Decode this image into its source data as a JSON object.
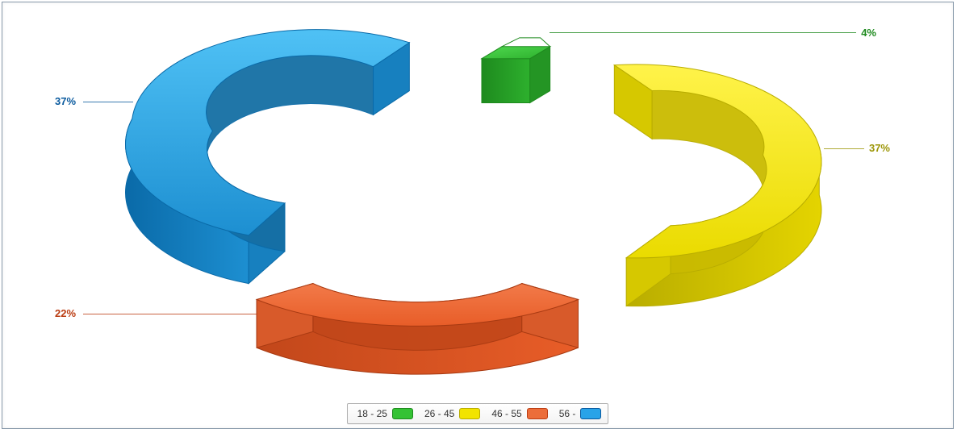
{
  "chart_data": {
    "type": "pie",
    "style": "3d-exploded-donut",
    "series": [
      {
        "name": "18 - 25",
        "value": 4,
        "label": "4%",
        "color": "#34c234"
      },
      {
        "name": "26 - 45",
        "value": 37,
        "label": "37%",
        "color": "#f2e400"
      },
      {
        "name": "46 - 55",
        "value": 22,
        "label": "22%",
        "color": "#ec6d3a"
      },
      {
        "name": "56 -",
        "value": 37,
        "label": "37%",
        "color": "#29a3e8"
      }
    ],
    "legend_position": "bottom"
  },
  "labels": {
    "green": "4%",
    "yellow": "37%",
    "orange": "22%",
    "blue": "37%"
  },
  "legend": {
    "items": [
      {
        "text": "18 - 25"
      },
      {
        "text": "26 - 45"
      },
      {
        "text": "46 - 55"
      },
      {
        "text": "56 -"
      }
    ]
  }
}
